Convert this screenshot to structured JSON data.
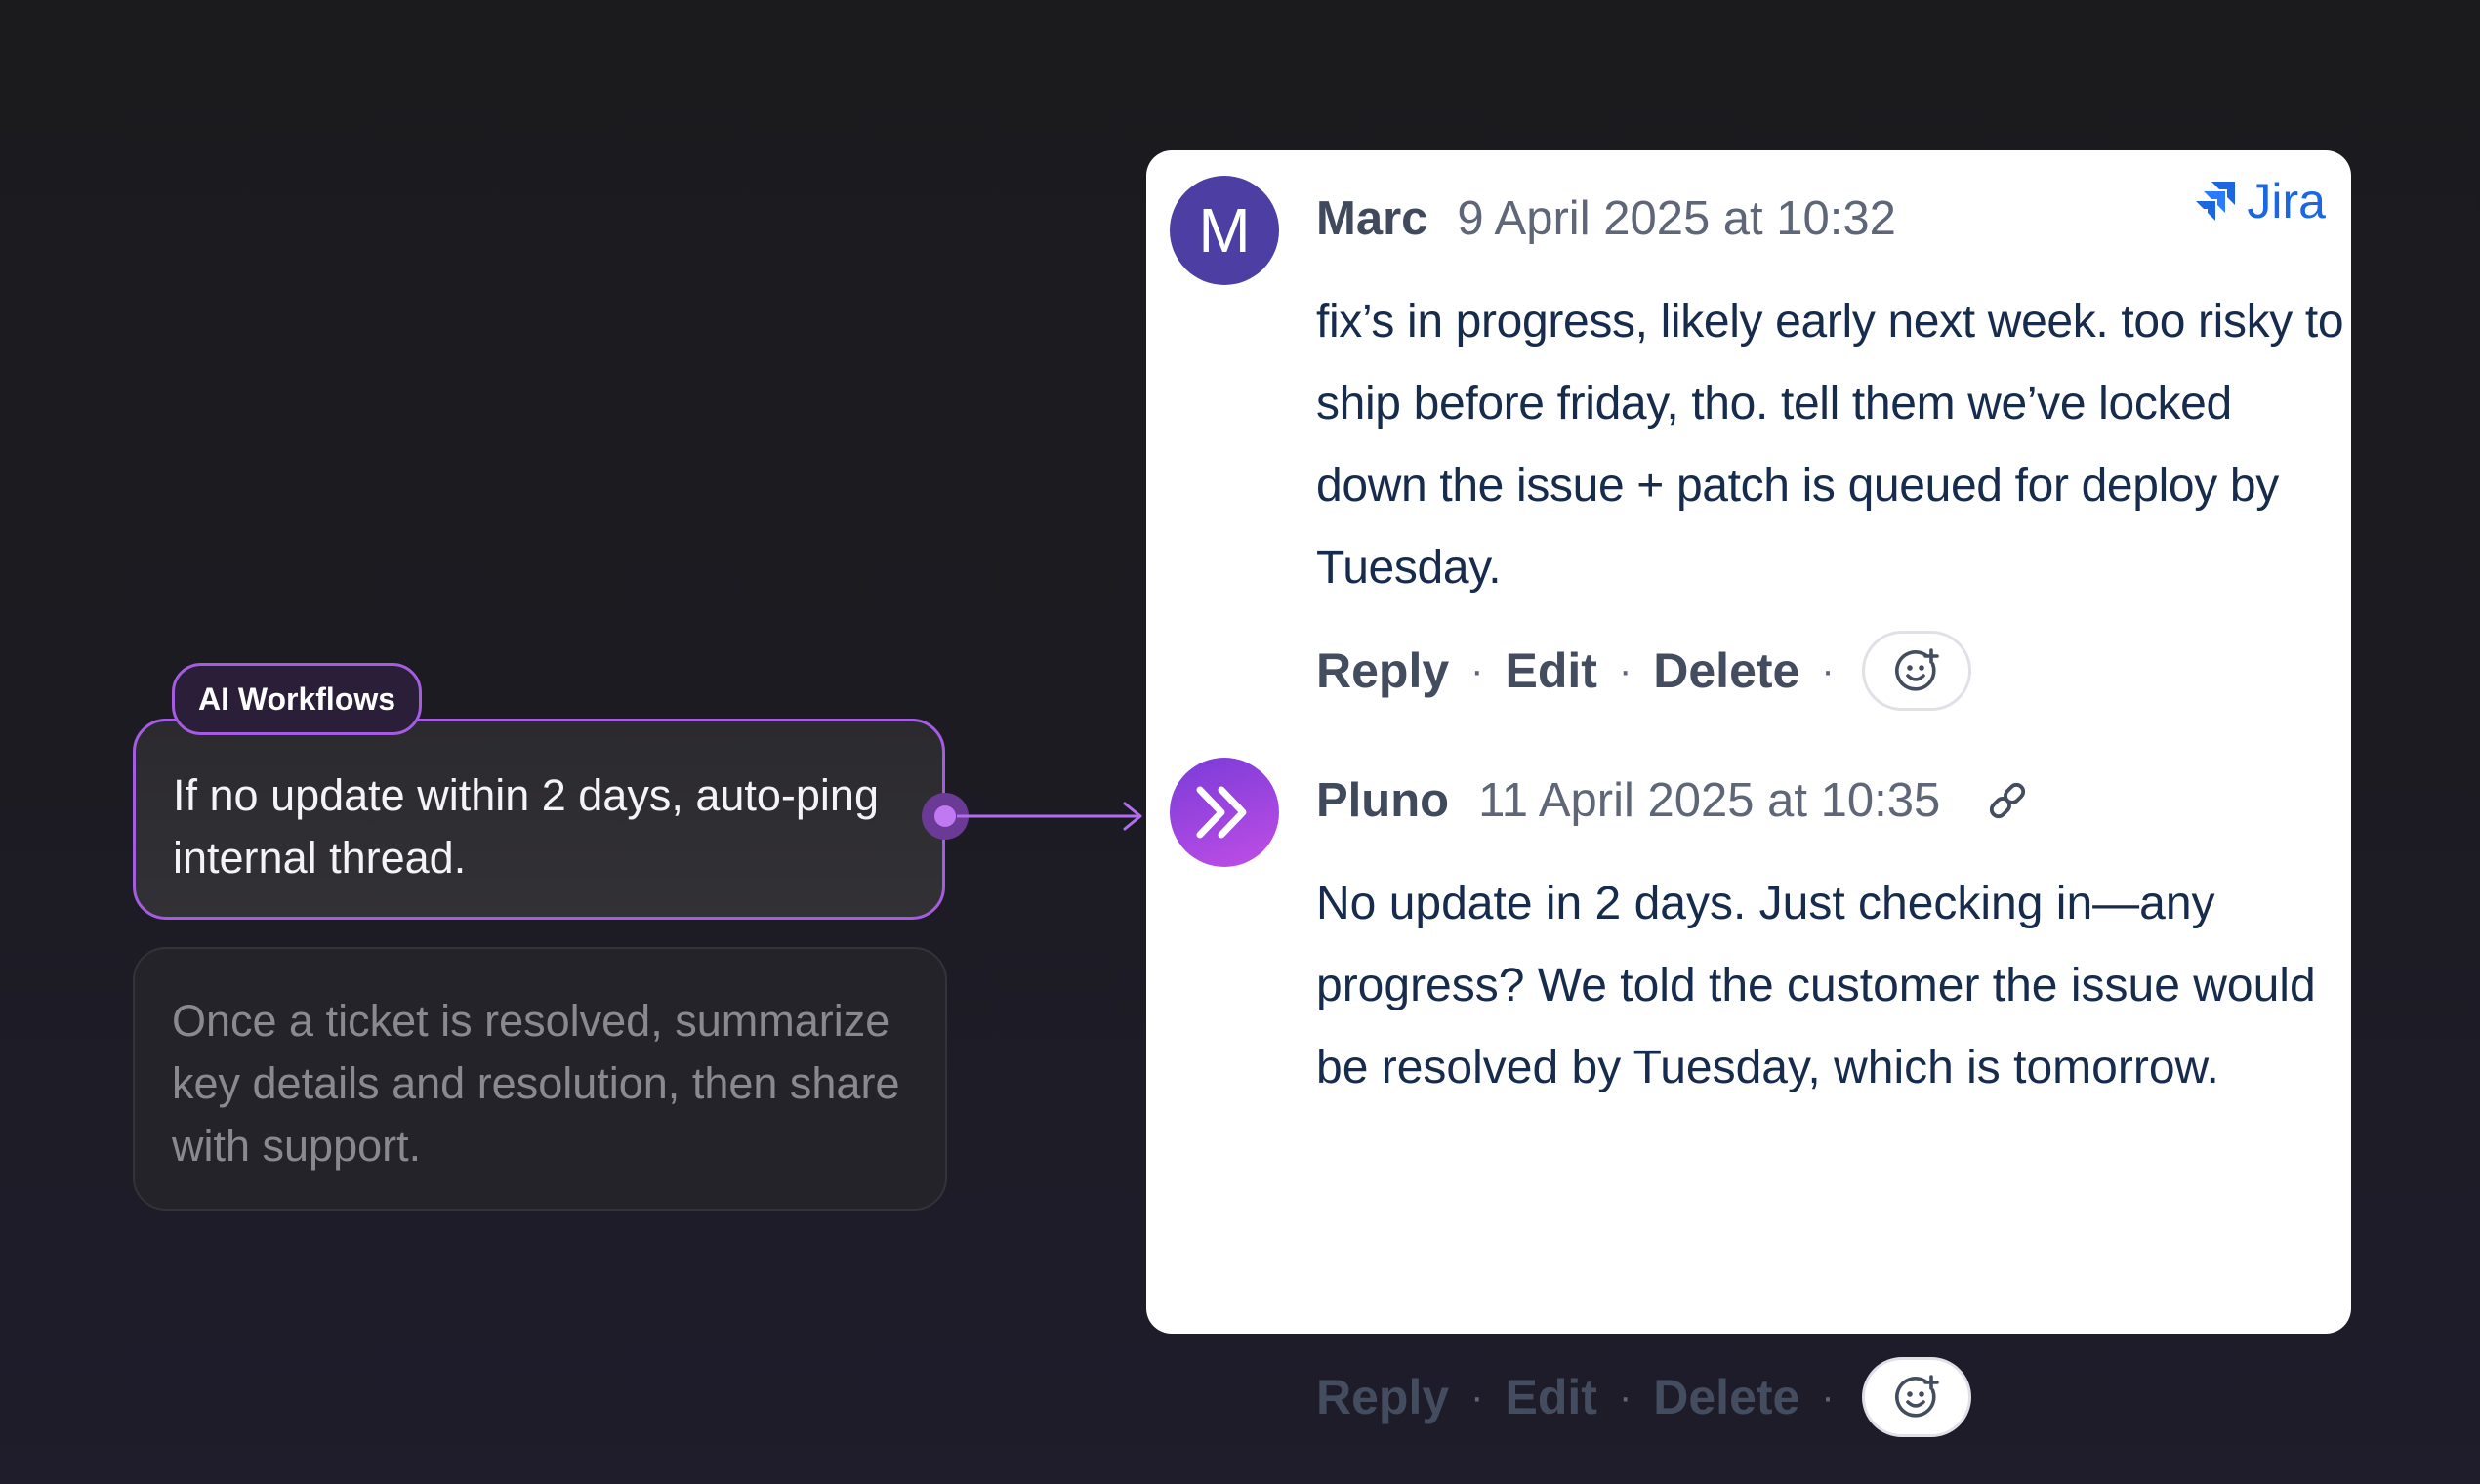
{
  "workflows": {
    "badge_label": "AI Workflows",
    "items": [
      {
        "text": "If no update within 2 days, auto-ping internal thread.",
        "state": "active"
      },
      {
        "text": "Once a ticket is resolved, summarize key details and resolution, then share with support.",
        "state": "inactive"
      }
    ]
  },
  "jira": {
    "logo_text": "Jira",
    "logo_icon": "jira-logo-icon",
    "comments": [
      {
        "author": "Marc",
        "avatar_initial": "M",
        "timestamp": "9 April 2025 at 10:32",
        "body": "fix’s in progress, likely early next week. too risky to ship before friday, tho. tell them we’ve locked down the issue + patch is queued for deploy by Tuesday.",
        "actions": {
          "reply": "Reply",
          "edit": "Edit",
          "delete": "Delete",
          "separator": "·"
        }
      },
      {
        "author": "Pluno",
        "avatar_icon": "pluno-logo-icon",
        "timestamp": "11 April 2025 at 10:35",
        "body": "No update in 2 days. Just checking in—any progress? We told the customer the issue would be resolved by Tuesday, which is tomorrow.",
        "actions": {
          "reply": "Reply",
          "edit": "Edit",
          "delete": "Delete",
          "separator": "·"
        }
      }
    ]
  },
  "colors": {
    "accent_purple": "#a45ce0",
    "jira_blue": "#1c67e0",
    "marc_avatar": "#4c3ea3",
    "text_dark": "#172b4d"
  }
}
